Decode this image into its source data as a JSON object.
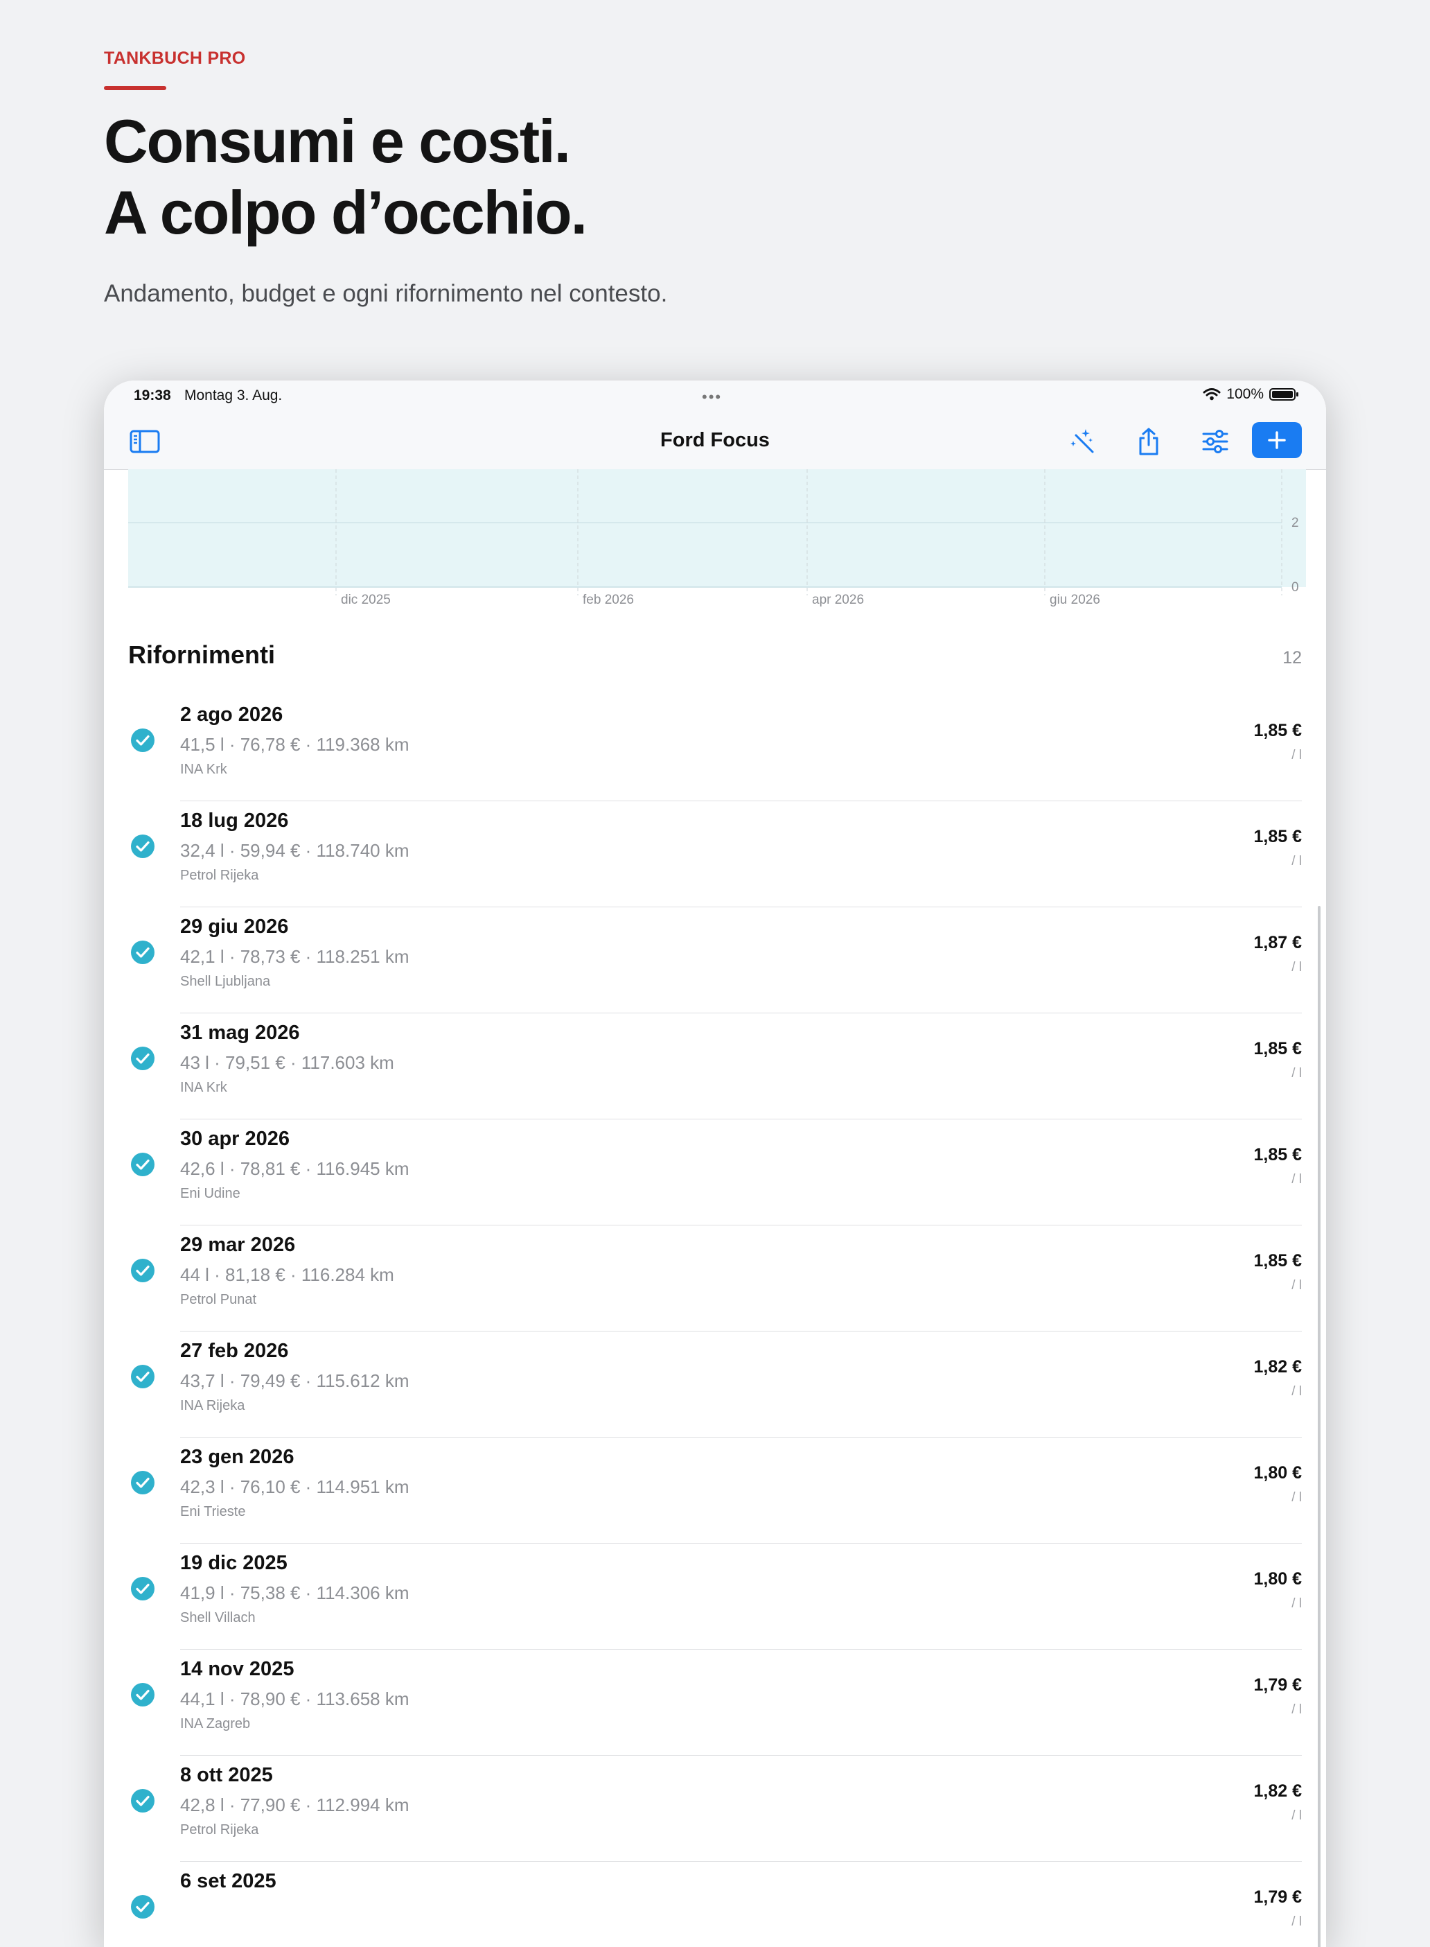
{
  "promo": {
    "eyebrow": "TANKBUCH PRO",
    "headline_line1": "Consumi e costi.",
    "headline_line2": "A colpo d’occhio.",
    "subline": "Andamento, budget e ogni rifornimento nel contesto."
  },
  "status_bar": {
    "time": "19:38",
    "date": "Montag 3. Aug.",
    "battery": "100%"
  },
  "nav": {
    "title": "Ford Focus",
    "icons": [
      "sidebar-icon",
      "magic-wand-icon",
      "share-icon",
      "sliders-icon",
      "plus-icon"
    ]
  },
  "chart": {
    "x_labels": [
      "dic 2025",
      "feb 2026",
      "apr 2026",
      "giu 2026"
    ],
    "y_labels": [
      "2",
      "0"
    ],
    "fill_color": "#e6f5f7"
  },
  "section": {
    "title": "Rifornimenti",
    "count": "12"
  },
  "refuels": [
    {
      "date": "2 ago 2026",
      "detail": "41,5 l · 76,78 € · 119.368 km",
      "station": "INA Krk",
      "price": "1,85 €",
      "unit": "/ l"
    },
    {
      "date": "18 lug 2026",
      "detail": "32,4 l · 59,94 € · 118.740 km",
      "station": "Petrol Rijeka",
      "price": "1,85 €",
      "unit": "/ l"
    },
    {
      "date": "29 giu 2026",
      "detail": "42,1 l · 78,73 € · 118.251 km",
      "station": "Shell Ljubljana",
      "price": "1,87 €",
      "unit": "/ l"
    },
    {
      "date": "31 mag 2026",
      "detail": "43 l · 79,51 € · 117.603 km",
      "station": "INA Krk",
      "price": "1,85 €",
      "unit": "/ l"
    },
    {
      "date": "30 apr 2026",
      "detail": "42,6 l · 78,81 € · 116.945 km",
      "station": "Eni Udine",
      "price": "1,85 €",
      "unit": "/ l"
    },
    {
      "date": "29 mar 2026",
      "detail": "44 l · 81,18 € · 116.284 km",
      "station": "Petrol Punat",
      "price": "1,85 €",
      "unit": "/ l"
    },
    {
      "date": "27 feb 2026",
      "detail": "43,7 l · 79,49 € · 115.612 km",
      "station": "INA Rijeka",
      "price": "1,82 €",
      "unit": "/ l"
    },
    {
      "date": "23 gen 2026",
      "detail": "42,3 l · 76,10 € · 114.951 km",
      "station": "Eni Trieste",
      "price": "1,80 €",
      "unit": "/ l"
    },
    {
      "date": "19 dic 2025",
      "detail": "41,9 l · 75,38 € · 114.306 km",
      "station": "Shell Villach",
      "price": "1,80 €",
      "unit": "/ l"
    },
    {
      "date": "14 nov 2025",
      "detail": "44,1 l · 78,90 € · 113.658 km",
      "station": "INA Zagreb",
      "price": "1,79 €",
      "unit": "/ l"
    },
    {
      "date": "8 ott 2025",
      "detail": "42,8 l · 77,90 € · 112.994 km",
      "station": "Petrol Rijeka",
      "price": "1,82 €",
      "unit": "/ l"
    },
    {
      "date": "6 set 2025",
      "detail": "",
      "station": "",
      "price": "1,79 €",
      "unit": "/ l"
    }
  ],
  "colors": {
    "accent_red": "#c8312f",
    "tint_blue": "#1a7cf2",
    "check_teal": "#2fb1cc"
  }
}
